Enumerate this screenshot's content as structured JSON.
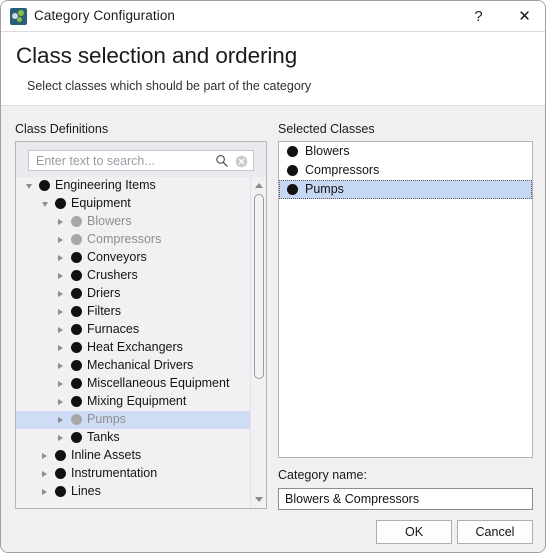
{
  "window": {
    "title": "Category Configuration",
    "icon": "category-icon",
    "help_label": "?",
    "close_label": "✕"
  },
  "header": {
    "title": "Class selection and ordering",
    "subtitle": "Select classes which should be part of the category"
  },
  "left_panel": {
    "label": "Class Definitions",
    "search": {
      "placeholder": "Enter text to search...",
      "value": "",
      "search_icon": "magnifier-icon",
      "clear_icon": "clear-circle-icon"
    },
    "tree": [
      {
        "label": "Engineering Items",
        "depth": 0,
        "twisty": "expanded",
        "dim": false,
        "selected": false
      },
      {
        "label": "Equipment",
        "depth": 1,
        "twisty": "expanded",
        "dim": false,
        "selected": false
      },
      {
        "label": "Blowers",
        "depth": 2,
        "twisty": "collapsed",
        "dim": true,
        "selected": false
      },
      {
        "label": "Compressors",
        "depth": 2,
        "twisty": "collapsed",
        "dim": true,
        "selected": false
      },
      {
        "label": "Conveyors",
        "depth": 2,
        "twisty": "collapsed",
        "dim": false,
        "selected": false
      },
      {
        "label": "Crushers",
        "depth": 2,
        "twisty": "collapsed",
        "dim": false,
        "selected": false
      },
      {
        "label": "Driers",
        "depth": 2,
        "twisty": "collapsed",
        "dim": false,
        "selected": false
      },
      {
        "label": "Filters",
        "depth": 2,
        "twisty": "collapsed",
        "dim": false,
        "selected": false
      },
      {
        "label": "Furnaces",
        "depth": 2,
        "twisty": "collapsed",
        "dim": false,
        "selected": false
      },
      {
        "label": "Heat Exchangers",
        "depth": 2,
        "twisty": "collapsed",
        "dim": false,
        "selected": false
      },
      {
        "label": "Mechanical Drivers",
        "depth": 2,
        "twisty": "collapsed",
        "dim": false,
        "selected": false
      },
      {
        "label": "Miscellaneous Equipment",
        "depth": 2,
        "twisty": "collapsed",
        "dim": false,
        "selected": false
      },
      {
        "label": "Mixing Equipment",
        "depth": 2,
        "twisty": "collapsed",
        "dim": false,
        "selected": false
      },
      {
        "label": "Pumps",
        "depth": 2,
        "twisty": "collapsed",
        "dim": true,
        "selected": true
      },
      {
        "label": "Tanks",
        "depth": 2,
        "twisty": "collapsed",
        "dim": false,
        "selected": false
      },
      {
        "label": "Inline Assets",
        "depth": 1,
        "twisty": "collapsed",
        "dim": false,
        "selected": false
      },
      {
        "label": "Instrumentation",
        "depth": 1,
        "twisty": "collapsed",
        "dim": false,
        "selected": false
      },
      {
        "label": "Lines",
        "depth": 1,
        "twisty": "collapsed",
        "dim": false,
        "selected": false
      }
    ],
    "scrollbar": {
      "up_icon": "scroll-up-arrow-icon",
      "down_icon": "scroll-down-arrow-icon"
    }
  },
  "right_panel": {
    "label": "Selected Classes",
    "items": [
      {
        "label": "Blowers",
        "selected": false
      },
      {
        "label": "Compressors",
        "selected": false
      },
      {
        "label": "Pumps",
        "selected": true
      }
    ]
  },
  "category_name": {
    "label": "Category name:",
    "value": "Blowers & Compressors"
  },
  "buttons": {
    "ok": "OK",
    "cancel": "Cancel"
  },
  "colors": {
    "selection_tree": "#cfdcf5",
    "selection_list": "#c5d7f2",
    "dialog_bg": "#f0f0f0",
    "panel_bg": "#f1f1f4"
  }
}
